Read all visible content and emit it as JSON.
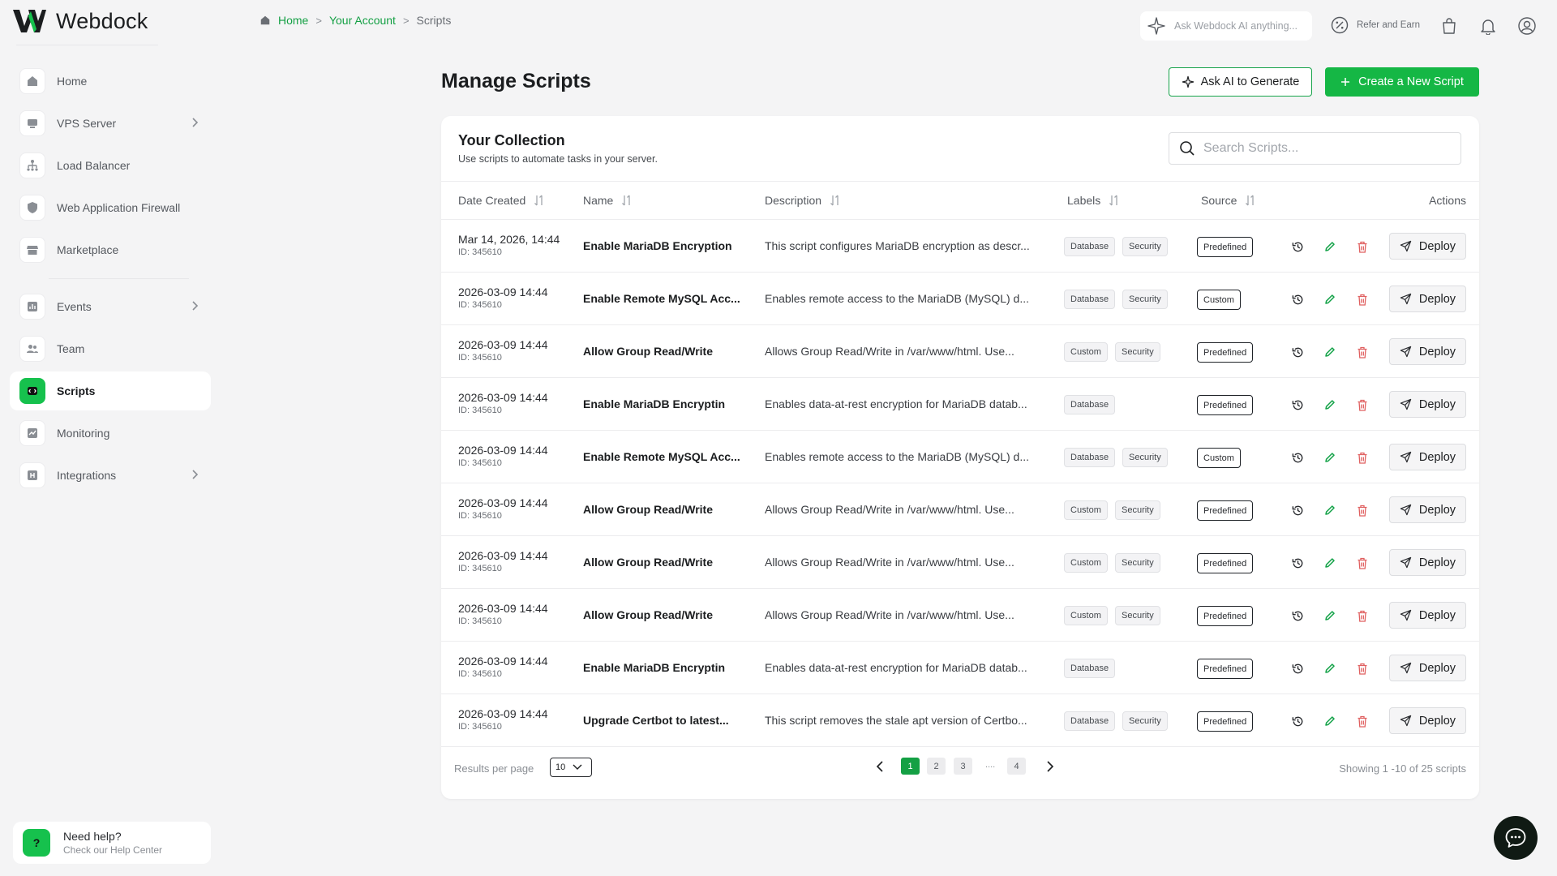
{
  "app": {
    "name": "Webdock"
  },
  "sidebar": {
    "items": [
      {
        "label": "Home",
        "icon": "home-icon"
      },
      {
        "label": "VPS Server",
        "icon": "server-icon"
      },
      {
        "label": "Load Balancer",
        "icon": "load-balancer-icon"
      },
      {
        "label": "Web Application Firewall",
        "icon": "shield-icon"
      },
      {
        "label": "Marketplace",
        "icon": "store-icon"
      },
      {
        "label": "Events",
        "icon": "events-icon"
      },
      {
        "label": "Team",
        "icon": "team-icon"
      },
      {
        "label": "Scripts",
        "icon": "scripts-icon",
        "active": true
      },
      {
        "label": "Monitoring",
        "icon": "monitoring-icon"
      },
      {
        "label": "Integrations",
        "icon": "integrations-icon"
      }
    ],
    "help": {
      "title": "Need help?",
      "subtitle": "Check our Help Center",
      "icon_text": "?"
    }
  },
  "breadcrumb": {
    "home": "Home",
    "account": "Your Account",
    "current": "Scripts",
    "separator": ">"
  },
  "topbar": {
    "ai_placeholder": "Ask Webdock AI anything...",
    "refer": "Refer and Earn"
  },
  "page": {
    "title": "Manage Scripts",
    "ask_ai_button": "Ask AI to Generate",
    "create_button": "Create a New Script"
  },
  "collection": {
    "title": "Your Collection",
    "subtitle": "Use scripts to automate tasks in your server.",
    "search_placeholder": "Search Scripts..."
  },
  "table": {
    "headers": {
      "date": "Date Created",
      "name": "Name",
      "description": "Description",
      "labels": "Labels",
      "source": "Source",
      "actions": "Actions"
    },
    "deploy_label": "Deploy",
    "rows": [
      {
        "date": "Mar 14, 2026, 14:44",
        "id": "ID: 345610",
        "name": "Enable MariaDB Encryption",
        "description": "This script configures MariaDB encryption as descr...",
        "labels": [
          "Database",
          "Security"
        ],
        "source": "Predefined"
      },
      {
        "date": "2026-03-09 14:44",
        "id": "ID: 345610",
        "name": "Enable Remote MySQL Acc...",
        "description": "Enables remote access to the MariaDB (MySQL) d...",
        "labels": [
          "Database",
          "Security"
        ],
        "source": "Custom"
      },
      {
        "date": "2026-03-09 14:44",
        "id": "ID: 345610",
        "name": "Allow Group Read/Write",
        "description": "Allows Group Read/Write in /var/www/html. Use...",
        "labels": [
          "Custom",
          "Security"
        ],
        "source": "Predefined"
      },
      {
        "date": "2026-03-09 14:44",
        "id": "ID: 345610",
        "name": "Enable MariaDB Encryptin",
        "description": "Enables data-at-rest encryption for MariaDB datab...",
        "labels": [
          "Database"
        ],
        "source": "Predefined"
      },
      {
        "date": "2026-03-09 14:44",
        "id": "ID: 345610",
        "name": "Enable Remote MySQL Acc...",
        "description": "Enables remote access to the MariaDB (MySQL) d...",
        "labels": [
          "Database",
          "Security"
        ],
        "source": "Custom"
      },
      {
        "date": "2026-03-09 14:44",
        "id": "ID: 345610",
        "name": "Allow Group Read/Write",
        "description": "Allows Group Read/Write in /var/www/html. Use...",
        "labels": [
          "Custom",
          "Security"
        ],
        "source": "Predefined"
      },
      {
        "date": "2026-03-09 14:44",
        "id": "ID: 345610",
        "name": "Allow Group Read/Write",
        "description": "Allows Group Read/Write in /var/www/html. Use...",
        "labels": [
          "Custom",
          "Security"
        ],
        "source": "Predefined"
      },
      {
        "date": "2026-03-09 14:44",
        "id": "ID: 345610",
        "name": "Allow Group Read/Write",
        "description": "Allows Group Read/Write in /var/www/html. Use...",
        "labels": [
          "Custom",
          "Security"
        ],
        "source": "Predefined"
      },
      {
        "date": "2026-03-09 14:44",
        "id": "ID: 345610",
        "name": "Enable MariaDB Encryptin",
        "description": "Enables data-at-rest encryption for MariaDB datab...",
        "labels": [
          "Database"
        ],
        "source": "Predefined"
      },
      {
        "date": "2026-03-09 14:44",
        "id": "ID: 345610",
        "name": "Upgrade Certbot to latest...",
        "description": "This script removes the stale apt version of Certbo...",
        "labels": [
          "Database",
          "Security"
        ],
        "source": "Predefined"
      }
    ]
  },
  "pagination": {
    "results_label": "Results per page",
    "per_page": "10",
    "pages": [
      "1",
      "2",
      "3",
      "4"
    ],
    "current": "1",
    "dots": "....",
    "showing": "Showing 1 -10 of 25 scripts"
  },
  "colors": {
    "accent": "#15b745",
    "link": "#14a044",
    "delete": "#e06060",
    "background": "#f4f4f5"
  }
}
